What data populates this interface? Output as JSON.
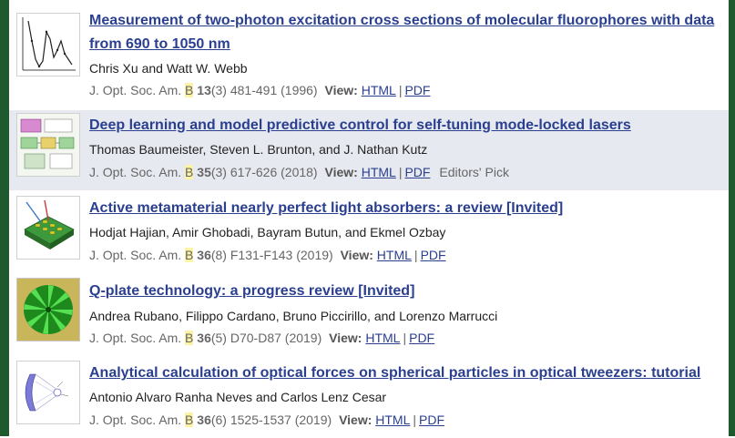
{
  "view_label": "View:",
  "html_label": "HTML",
  "pdf_label": "PDF",
  "separator": "|",
  "articles": [
    {
      "title": "Measurement of two-photon excitation cross sections of molecular fluorophores with data from 690 to 1050 nm",
      "authors": "Chris Xu and Watt W. Webb",
      "journal": "J. Opt. Soc. Am.",
      "section": "B",
      "volume": "13",
      "issue_pages": "(3) 481-491 (1996)",
      "badge": ""
    },
    {
      "title": "Deep learning and model predictive control for self-tuning mode-locked lasers",
      "authors": "Thomas Baumeister, Steven L. Brunton, and J. Nathan Kutz",
      "journal": "J. Opt. Soc. Am.",
      "section": "B",
      "volume": "35",
      "issue_pages": "(3) 617-626 (2018)",
      "badge": "Editors' Pick"
    },
    {
      "title": "Active metamaterial nearly perfect light absorbers: a review [Invited]",
      "authors": "Hodjat Hajian, Amir Ghobadi, Bayram Butun, and Ekmel Ozbay",
      "journal": "J. Opt. Soc. Am.",
      "section": "B",
      "volume": "36",
      "issue_pages": "(8) F131-F143 (2019)",
      "badge": ""
    },
    {
      "title": "Q-plate technology: a progress review [Invited]",
      "authors": "Andrea Rubano, Filippo Cardano, Bruno Piccirillo, and Lorenzo Marrucci",
      "journal": "J. Opt. Soc. Am.",
      "section": "B",
      "volume": "36",
      "issue_pages": "(5) D70-D87 (2019)",
      "badge": ""
    },
    {
      "title": "Analytical calculation of optical forces on spherical particles in optical tweezers: tutorial",
      "authors": "Antonio Alvaro Ranha Neves and Carlos Lenz Cesar",
      "journal": "J. Opt. Soc. Am.",
      "section": "B",
      "volume": "36",
      "issue_pages": "(6) 1525-1537 (2019)",
      "badge": ""
    }
  ]
}
